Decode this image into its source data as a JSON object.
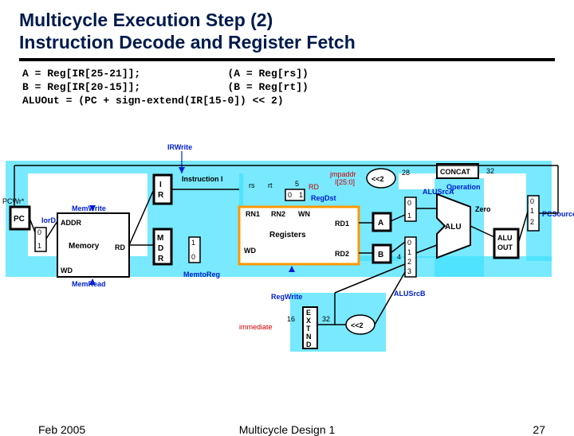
{
  "title_l1": "Multicycle Execution Step (2)",
  "title_l2": "Instruction Decode and Register Fetch",
  "code_line1": "A = Reg[IR[25-21]];              (A = Reg[rs])",
  "code_line2": "B = Reg[IR[20-15]];              (B = Reg[rt])",
  "code_line3": "ALUOut = (PC + sign-extend(IR[15-0]) << 2)",
  "labels": {
    "pcwr": "PCWr*",
    "iord": "IorD",
    "memwrite": "MemWrite",
    "memread": "MemRead",
    "irwrite": "IRWrite",
    "regdst": "RegDst",
    "memtoreg": "MemtoReg",
    "regwrite": "RegWrite",
    "alusrca": "ALUSrcA",
    "alusrcb": "ALUSrcB",
    "operation": "Operation",
    "pcsource": "PCSource",
    "zero": "Zero",
    "instruction": "Instruction I",
    "jmpaddr": "jmpaddr",
    "i250": "I[25:0]",
    "immediate": "immediate",
    "rs": "rs",
    "rt": "rt",
    "rd": "RD",
    "five": "5",
    "mux0": "0",
    "mux1": "1",
    "mux2": "2",
    "mux3": "3",
    "four": "4",
    "shl2a": "<<2",
    "shl2b": "<<2",
    "n28": "28",
    "n32": "32",
    "concat": "CONCAT",
    "pc": "PC",
    "addr": "ADDR",
    "memory": "Memory",
    "wd": "WD",
    "ir": "I\nR",
    "mdr": "M\nD\nR",
    "rn1": "RN1",
    "rn2": "RN2",
    "wn": "WN",
    "wd2": "WD",
    "registers": "Registers",
    "rd1": "RD1",
    "rd2": "RD2",
    "a": "A",
    "b": "B",
    "alu": "ALU",
    "aluout": "ALU\nOUT",
    "extnd": "E\nX\nT\nN\nD",
    "n16": "16"
  },
  "footer": {
    "left": "Feb 2005",
    "center": "Multicycle Design 1",
    "right": "27"
  }
}
